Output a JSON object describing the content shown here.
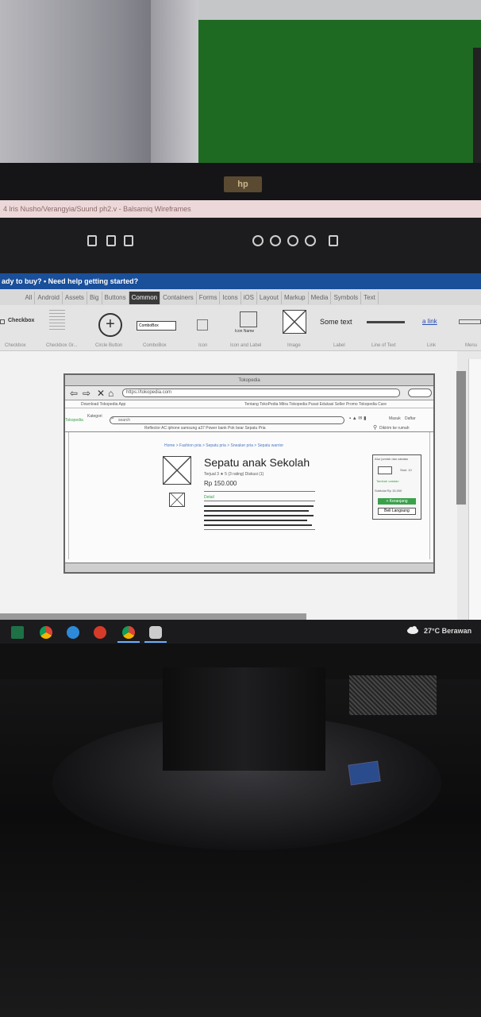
{
  "window_title": "4 lris Nusho/Verangyia/Suund ph2.v - Balsamiq Wireframes",
  "help_bar": "ady to buy?  •  Need help getting started?",
  "tabs": [
    "All",
    "Android",
    "Assets",
    "Big",
    "Buttons",
    "Common",
    "Containers",
    "Forms",
    "Icons",
    "iOS",
    "Layout",
    "Markup",
    "Media",
    "Symbols",
    "Text"
  ],
  "active_tab": "Common",
  "library": {
    "checkbox": "Checkbox",
    "combobox": "ComboBox",
    "icon_name": "Icon Name",
    "some_text": "Some text",
    "link": "a link",
    "labels": [
      "Checkbox",
      "Checkbox Gr...",
      "Circle Button",
      "ComboBox",
      "Icon",
      "Icon and Label",
      "Image",
      "Label",
      "Line of Text",
      "Link",
      "Menu"
    ]
  },
  "wireframe": {
    "window_title": "Tokopedia",
    "url": "https://tokopedia.com",
    "topbar_left": "Download Tokopedia App",
    "topbar_right": "Tentang TokoPedia  Mitra Tokopedia  Pusat Edukasi Seller  Promo  Tokopedia Care",
    "brand": "Tokopedia",
    "kategori": "Kategori",
    "search_placeholder": "search",
    "suggestions": "Reflector AC  iphone  samsung  a37  Power bank  Pok bear  Sepatu Pria",
    "masuk": "Masuk",
    "daftar": "Daftar",
    "location": "Dikirim ke rumah",
    "breadcrumb": "Home > Fashion pria > Sepatu pria > Sneaker pria > Sepatu warrior",
    "product_name": "Sepatu anak Sekolah",
    "meta": "Terjual 3   ★   5 (3 rating)   Diskusi (1)",
    "price": "Rp 150.000",
    "detail_label": "Detail",
    "side_title": "Atur jumlah dan catatan",
    "stock": "Stok: 10",
    "note": "Tambah catatan",
    "subtotal": "Subtotal  Rp 15.000",
    "btn_cart": "+ Keranjang",
    "btn_buy": "Beli Langsung"
  },
  "taskbar": {
    "weather": "27°C  Berawan",
    "apps": [
      "excel",
      "chrome",
      "edge",
      "pdf-reader",
      "chrome-active",
      "balsamiq"
    ]
  }
}
